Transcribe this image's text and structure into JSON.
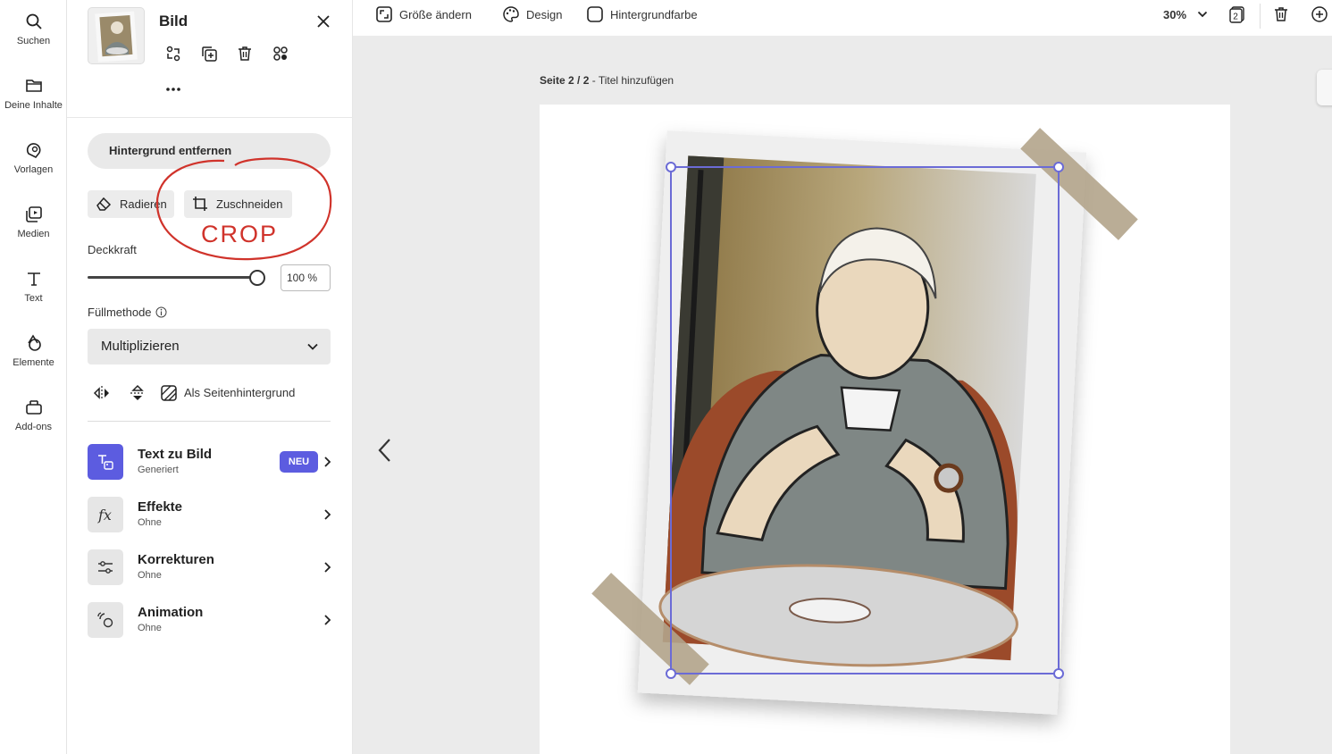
{
  "rail": {
    "items": [
      {
        "label": "Suchen",
        "icon": "search-icon"
      },
      {
        "label": "Deine Inhalte",
        "icon": "folder-icon"
      },
      {
        "label": "Vorlagen",
        "icon": "templates-icon"
      },
      {
        "label": "Medien",
        "icon": "media-icon"
      },
      {
        "label": "Text",
        "icon": "text-icon"
      },
      {
        "label": "Elemente",
        "icon": "elements-icon"
      },
      {
        "label": "Add-ons",
        "icon": "addons-icon"
      }
    ]
  },
  "panel": {
    "title": "Bild",
    "remove_bg_label": "Hintergrund entfernen",
    "erase_label": "Radieren",
    "crop_label": "Zuschneiden",
    "annotation_text": "CROP",
    "annotation_color": "#d0332b",
    "opacity_label": "Deckkraft",
    "opacity_value": "100 %",
    "opacity_fraction": 1.0,
    "blend_label": "Füllmethode",
    "blend_value": "Multiplizieren",
    "page_background_label": "Als Seitenhintergrund",
    "features": [
      {
        "title": "Text zu Bild",
        "subtitle": "Generiert",
        "badge": "NEU",
        "icon": "text-to-image-icon"
      },
      {
        "title": "Effekte",
        "subtitle": "Ohne",
        "icon": "fx-icon"
      },
      {
        "title": "Korrekturen",
        "subtitle": "Ohne",
        "icon": "adjustments-icon"
      },
      {
        "title": "Animation",
        "subtitle": "Ohne",
        "icon": "animation-icon"
      }
    ],
    "badge_color": "#5c5ce0"
  },
  "topbar": {
    "resize_label": "Größe ändern",
    "design_label": "Design",
    "bg_color_label": "Hintergrundfarbe",
    "zoom_value": "30%",
    "pages_count": "2"
  },
  "canvas": {
    "page_label_bold": "Seite 2 / 2",
    "page_label_sep": " - ",
    "page_title_placeholder": "Titel hinzufügen",
    "selection_color": "#6b6bd6"
  }
}
